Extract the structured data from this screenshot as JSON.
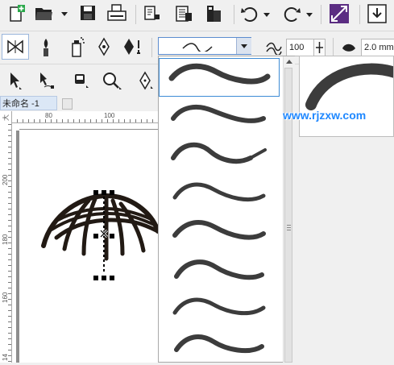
{
  "document": {
    "tab_title": "未命名 -1"
  },
  "rulers": {
    "horizontal": [
      "80",
      "100"
    ],
    "vertical": [
      "200",
      "180",
      "160",
      "14"
    ],
    "corner": "大"
  },
  "properties": {
    "artistic_width": "100",
    "line_width": "2.0 mm"
  },
  "brush_presets": {
    "count_visible": 8,
    "selected_index": 0
  },
  "watermark": "www.rjzxw.com",
  "icons": {
    "toolbar1": [
      "new-document-icon",
      "open-folder-icon",
      "save-icon",
      "print-icon",
      "import-icon",
      "export-icon",
      "publish-icon",
      "undo-icon",
      "redo-icon",
      "full-screen-icon",
      "download-icon"
    ],
    "toolbar2": [
      "preset-brush-icon",
      "brush-icon",
      "spray-icon",
      "calligraphy-icon",
      "pressure-icon",
      "smoothing-icon"
    ]
  }
}
